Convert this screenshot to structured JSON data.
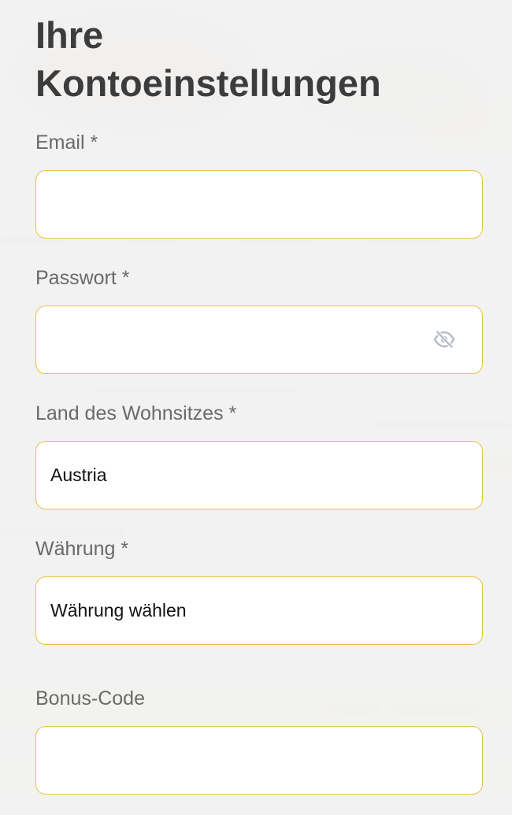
{
  "page_title": "Ihre\nKontoeinstellungen",
  "title_lines": [
    "Ihre",
    "Kontoeinstellungen"
  ],
  "fields": {
    "email": {
      "label": "Email *",
      "value": ""
    },
    "password": {
      "label": "Passwort *",
      "value": "",
      "toggle_icon": "eye-slash-icon"
    },
    "country": {
      "label": "Land des Wohnsitzes *",
      "value": "Austria"
    },
    "currency": {
      "label": "Währung *",
      "value": "Währung wählen"
    },
    "bonus": {
      "label": "Bonus-Code",
      "value": ""
    }
  },
  "colors": {
    "field_border": "#e5c24a",
    "label": "#6a6a6a",
    "title": "#3c3c3c",
    "icon": "#b8bcc6"
  }
}
